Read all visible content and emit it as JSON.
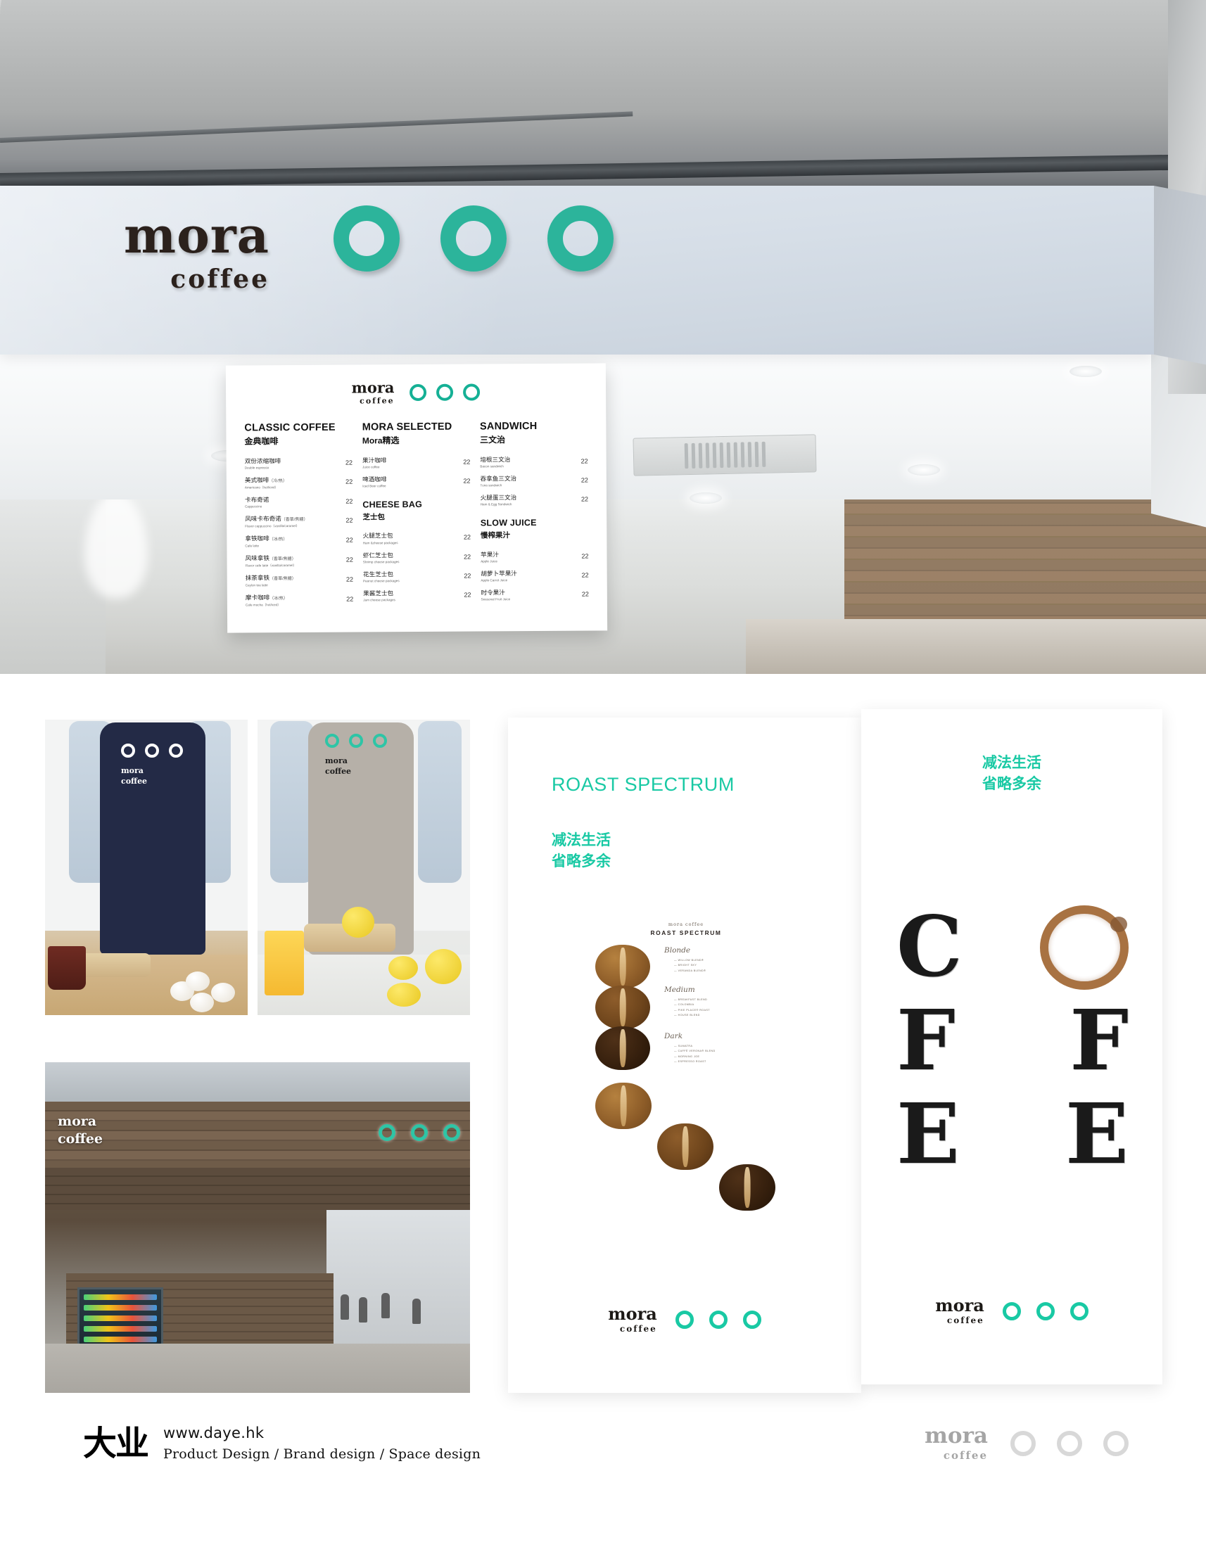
{
  "brand": {
    "name": "mora",
    "sub": "coffee",
    "accent": "#19c9a4",
    "sign_accent": "#2cb49b",
    "ink": "#1d1a17"
  },
  "hero": {
    "sign_word": "mora",
    "sign_sub": "coffee"
  },
  "menu": {
    "logo_word": "mora",
    "logo_sub": "coffee",
    "columns": [
      {
        "head_en": "CLASSIC COFFEE",
        "head_cn": "金典咖啡",
        "items": [
          {
            "cn": "双份浓缩咖啡",
            "paren": "",
            "en": "Double espresso",
            "price": "22"
          },
          {
            "cn": "美式咖啡",
            "paren": "（冷/热）",
            "en": "Americano（hot/iced）",
            "price": "22"
          },
          {
            "cn": "卡布奇诺",
            "paren": "",
            "en": "Cappuccino",
            "price": "22"
          },
          {
            "cn": "风味卡布奇诺",
            "paren": "（香草/焦糖）",
            "en": "Flavor cappuccino（vanilla/caramel）",
            "price": "22"
          },
          {
            "cn": "拿铁咖啡",
            "paren": "（冰/热）",
            "en": "Cafe latte",
            "price": "22"
          },
          {
            "cn": "风味拿铁",
            "paren": "（香草/焦糖）",
            "en": "Flavor cafe latte（vanilla/caramel）",
            "price": "22"
          },
          {
            "cn": "抹茶拿铁",
            "paren": "（香草/焦糖）",
            "en": "Ceylon tea latte",
            "price": "22"
          },
          {
            "cn": "摩卡咖啡",
            "paren": "（冰/热）",
            "en": "Cafe mocha（hot/iced）",
            "price": "22"
          }
        ],
        "sub": null
      },
      {
        "head_en": "MORA SELECTED",
        "head_cn": "Mora精选",
        "items": [
          {
            "cn": "果汁咖啡",
            "paren": "",
            "en": "Juice coffee",
            "price": "22"
          },
          {
            "cn": "啤酒咖啡",
            "paren": "",
            "en": "Iced Beer coffee",
            "price": "22"
          }
        ],
        "sub": {
          "head_en": "CHEESE BAG",
          "head_cn": "芝士包",
          "items": [
            {
              "cn": "火腿芝士包",
              "paren": "",
              "en": "Ham &cheese packages",
              "price": "22"
            },
            {
              "cn": "虾仁芝士包",
              "paren": "",
              "en": "Shrimp cheese packages",
              "price": "22"
            },
            {
              "cn": "花生芝士包",
              "paren": "",
              "en": "Peanut cheese packages",
              "price": "22"
            },
            {
              "cn": "果酱芝士包",
              "paren": "",
              "en": "Jam cheese packages",
              "price": "22"
            }
          ]
        }
      },
      {
        "head_en": "SANDWICH",
        "head_cn": "三文治",
        "items": [
          {
            "cn": "培根三文治",
            "paren": "",
            "en": "Bacon sandwich",
            "price": "22"
          },
          {
            "cn": "吞拿鱼三文治",
            "paren": "",
            "en": "Tuna sandwich",
            "price": "22"
          },
          {
            "cn": "火腿蛋三文治",
            "paren": "",
            "en": "Ham & Egg Sandwich",
            "price": "22"
          }
        ],
        "sub": {
          "head_en": "SLOW JUICE",
          "head_cn": "慢榨果汁",
          "items": [
            {
              "cn": "苹果汁",
              "paren": "",
              "en": "Apple Juice",
              "price": "22"
            },
            {
              "cn": "胡萝卜苹果汁",
              "paren": "",
              "en": "Apple Carrot Juice",
              "price": "22"
            },
            {
              "cn": "时令果汁",
              "paren": "",
              "en": "Seasonal Fruit Juice",
              "price": "22"
            }
          ]
        }
      }
    ]
  },
  "aprons": {
    "navy_word": "mora",
    "navy_sub": "coffee",
    "grey_word": "mora",
    "grey_sub": "coffee"
  },
  "kiosk": {
    "sign_word": "mora",
    "sign_sub": "coffee"
  },
  "poster_a": {
    "title": "ROAST SPECTRUM",
    "cn_line1": "减法生活",
    "cn_line2": "省略多余",
    "logo_word": "mora",
    "logo_sub": "coffee",
    "art": {
      "brand": "mora  coffee",
      "title": "ROAST SPECTRUM",
      "groups": [
        {
          "label": "Blonde",
          "items": [
            "WILLOW BLEND®",
            "BRIGHT SKY",
            "VERANDA BLEND®"
          ]
        },
        {
          "label": "Medium",
          "items": [
            "BREAKFAST BLEND",
            "COLOMBIA",
            "PIKE PLACE® ROAST",
            "HOUSE BLEND"
          ]
        },
        {
          "label": "Dark",
          "items": [
            "SUMATRA",
            "CAFFÈ VERONA® BLEND",
            "MORNING JOE",
            "ESPRESSO ROAST"
          ]
        }
      ]
    }
  },
  "poster_b": {
    "cn_line1": "减法生活",
    "cn_line2": "省略多余",
    "letters": [
      [
        "C",
        "O"
      ],
      [
        "F",
        "F"
      ],
      [
        "E",
        "E"
      ]
    ],
    "logo_word": "mora",
    "logo_sub": "coffee"
  },
  "footer": {
    "mark": "大业",
    "url": "www.daye.hk",
    "services": "Product Design  /  Brand design  /  Space design",
    "logo_word": "mora",
    "logo_sub": "coffee"
  }
}
